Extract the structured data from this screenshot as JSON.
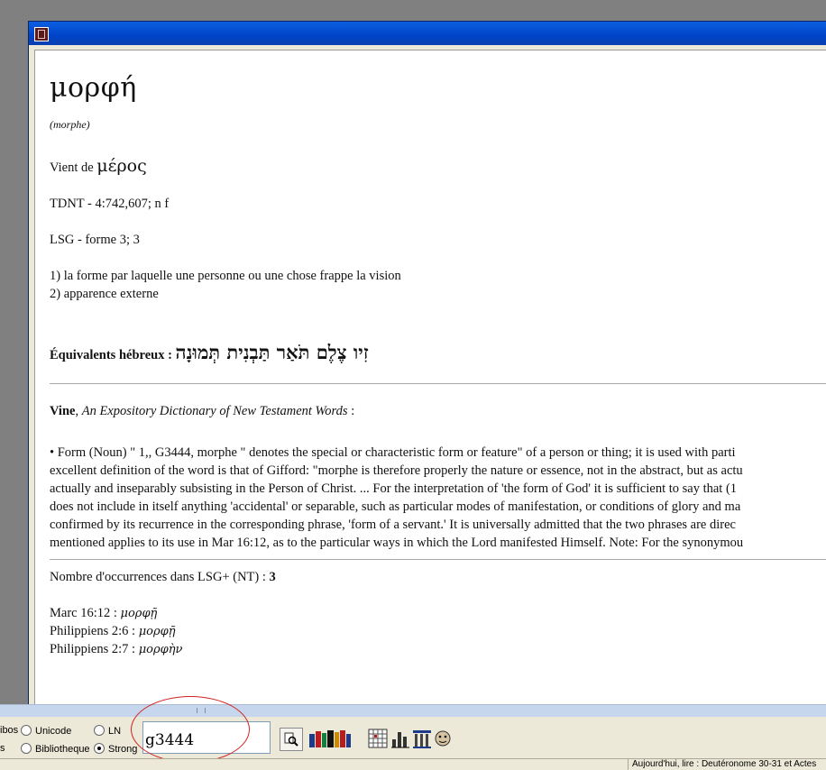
{
  "entry": {
    "headword": "μορφή",
    "transliteration": "(morphe)",
    "derivation_prefix": "Vient de ",
    "derivation_greek": "μέρος",
    "tdnt": "TDNT - 4:742,607; n f",
    "lsg": "LSG - forme 3; 3",
    "definitions": [
      "1) la forme par laquelle une personne ou une chose frappe la vision",
      "2) apparence externe"
    ],
    "hebrew_label": "Équivalents hébreux",
    "hebrew_colon": " : ",
    "hebrew_words": "זִיו צֶלֶם תֹּאַר תַּבְנִית תְּמוּנָה"
  },
  "vine": {
    "author": "Vine",
    "separator": ", ",
    "title": "An Expository Dictionary of New Testament Words",
    "colon": " :",
    "lines": [
      "• Form (Noun) \" 1,, G3444, morphe \" denotes the special or characteristic form or feature\" of a person or thing; it is used with parti",
      "excellent definition of the word is that of Gifford: \"morphe is therefore properly the nature or essence, not in the abstract, but as actu",
      "actually and inseparably subsisting in the Person of Christ. ... For the interpretation of 'the form of God' it is sufficient to say that (1",
      "does not include in itself anything 'accidental' or separable, such as particular modes of manifestation, or conditions of glory and ma",
      "confirmed by its recurrence in the corresponding phrase, 'form of a servant.' It is universally admitted that the two phrases are direc",
      "mentioned applies to its use in Mar 16:12, as to the particular ways in which the Lord manifested Himself. Note: For the synonymou"
    ]
  },
  "occurrences": {
    "label": "Nombre d'occurrences dans LSG+ (NT) : ",
    "count": "3",
    "refs": [
      {
        "ref": "Marc 16:12 : ",
        "greek": "μορφῇ"
      },
      {
        "ref": "Philippiens 2:6 : ",
        "greek": "μορφῇ"
      },
      {
        "ref": "Philippiens 2:7 : ",
        "greek": "μορφὴν"
      }
    ]
  },
  "toolbar": {
    "opt_partial_top": "ibos",
    "opt_partial_bottom": "s",
    "opt_unicode": "Unicode",
    "opt_ln": "LN",
    "opt_bibliotheque": "Bibliotheque",
    "opt_strong": "Strong",
    "search_value": "g3444"
  },
  "status": {
    "text": "Aujourd'hui, lire : Deutéronome 30-31 et Actes"
  },
  "icons": [
    "app-icon",
    "search-icon",
    "books-icon",
    "grid-icon",
    "chart-icon",
    "columns-icon",
    "face-icon"
  ]
}
